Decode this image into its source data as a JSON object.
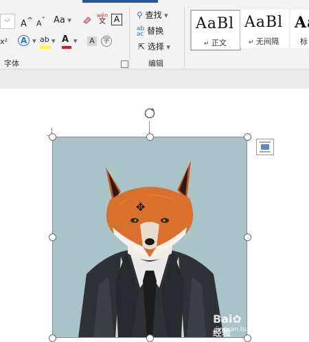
{
  "ribbon": {
    "font_group": {
      "label": "字体",
      "grow_font": "A",
      "shrink_font": "A",
      "change_case": "Aa",
      "phonetic_top": "wén",
      "phonetic_bottom": "文",
      "char_border": "A",
      "superscript": "x²",
      "text_effect": "A",
      "highlight": "ab",
      "font_color": "A",
      "enclose": "字"
    },
    "edit_group": {
      "label": "编辑",
      "find": "查找",
      "replace": "替换",
      "select": "选择"
    },
    "styles": [
      {
        "sample": "AaBl",
        "name": "正文"
      },
      {
        "sample": "AaBl",
        "name": "无间隔"
      },
      {
        "sample": "Aa",
        "name": "标"
      }
    ]
  },
  "colors": {
    "accent_blue": "#2b579a",
    "highlight_yellow": "#ffff00",
    "font_red": "#e81123",
    "image_bg": "#a9c4c8"
  },
  "watermark": {
    "brand": "Bai",
    "brand_suffix": "经验",
    "url": "jingyan.baidu.com"
  }
}
